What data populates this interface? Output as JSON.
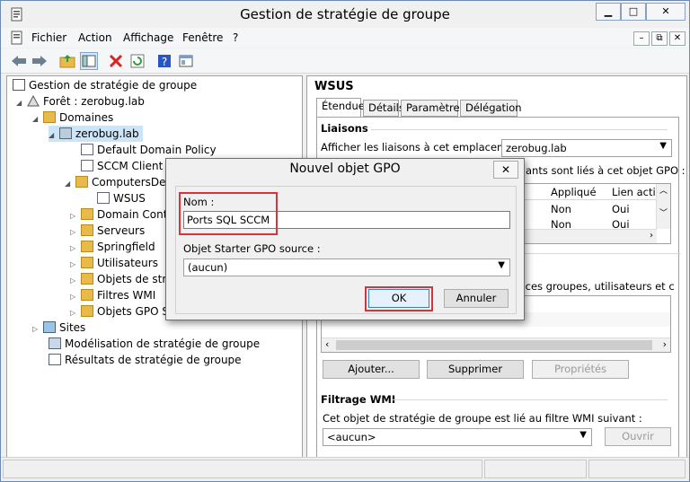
{
  "window": {
    "title": "Gestion de stratégie de groupe",
    "min": "▁",
    "max": "□",
    "close": "✕"
  },
  "menu": [
    "Fichier",
    "Action",
    "Affichage",
    "Fenêtre",
    "?"
  ],
  "mdi": {
    "min": "–",
    "restore": "⧉",
    "close": "✕"
  },
  "tree": {
    "root": "Gestion de stratégie de groupe",
    "forest": "Forêt : zerobug.lab",
    "domains": "Domaines",
    "domain": "zerobug.lab",
    "items": [
      "Default Domain Policy",
      "SCCM Client P",
      "ComputersDe",
      "WSUS",
      "Domain Contr",
      "Serveurs",
      "Springfield",
      "Utilisateurs",
      "Objets de strat",
      "Filtres WMI",
      "Objets GPO St"
    ],
    "sites": "Sites",
    "modeling": "Modélisation de stratégie de groupe",
    "results": "Résultats de stratégie de groupe"
  },
  "right": {
    "title": "WSUS",
    "tabs": [
      "Étendue",
      "Détails",
      "Paramètres",
      "Délégation"
    ],
    "links_heading": "Liaisons",
    "links_label": "Afficher les liaisons à cet emplacement :",
    "links_value": "zerobug.lab",
    "links_note": "ants sont liés à cet objet GPO :",
    "grid_headers": [
      "Appliqué",
      "Lien activ"
    ],
    "grid_rows": [
      [
        "Non",
        "Oui"
      ],
      [
        "Non",
        "Oui"
      ]
    ],
    "security_note": "t qu'à ces groupes, utilisateurs et c",
    "btn_add": "Ajouter...",
    "btn_remove": "Supprimer",
    "btn_props": "Propriétés",
    "wmi_heading": "Filtrage WMI",
    "wmi_label": "Cet objet de stratégie de groupe est lié au filtre WMI suivant :",
    "wmi_value": "<aucun>",
    "btn_open": "Ouvrir"
  },
  "dialog": {
    "title": "Nouvel objet GPO",
    "close": "✕",
    "name_label": "Nom :",
    "name_value": "Ports SQL SCCM",
    "starter_label": "Objet Starter GPO source :",
    "starter_value": "(aucun)",
    "ok": "OK",
    "cancel": "Annuler"
  },
  "colors": {
    "highlight": "#d9343b",
    "folder": "#e9b949"
  }
}
